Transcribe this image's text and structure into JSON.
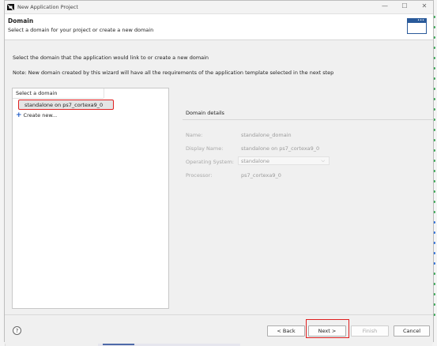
{
  "window": {
    "title": "New Application Project",
    "minimize_label": "—",
    "maximize_label": "☐",
    "close_label": "✕"
  },
  "header": {
    "title": "Domain",
    "description": "Select a domain for your project or create a new domain"
  },
  "main": {
    "intro": "Select the domain that the application would link to or create a new domain",
    "note": "Note: New domain created by this wizard will have all the requirements of the application template selected in the next step"
  },
  "domain_list": {
    "header": "Select a domain",
    "items": [
      {
        "label": "standalone on ps7_cortexa9_0"
      }
    ],
    "create_new": "Create new..."
  },
  "domain_details": {
    "title": "Domain details",
    "name_label": "Name:",
    "name_value": "standalone_domain",
    "display_name_label": "Display Name:",
    "display_name_value": "standalone on ps7_cortexa9_0",
    "os_label": "Operating System:",
    "os_value": "standalone",
    "processor_label": "Processor:",
    "processor_value": "ps7_cortexa9_0"
  },
  "footer": {
    "help": "?",
    "back": "< Back",
    "next": "Next >",
    "finish": "Finish",
    "cancel": "Cancel"
  },
  "colors": {
    "highlight": "#e02020",
    "accent": "#1a58c6"
  }
}
